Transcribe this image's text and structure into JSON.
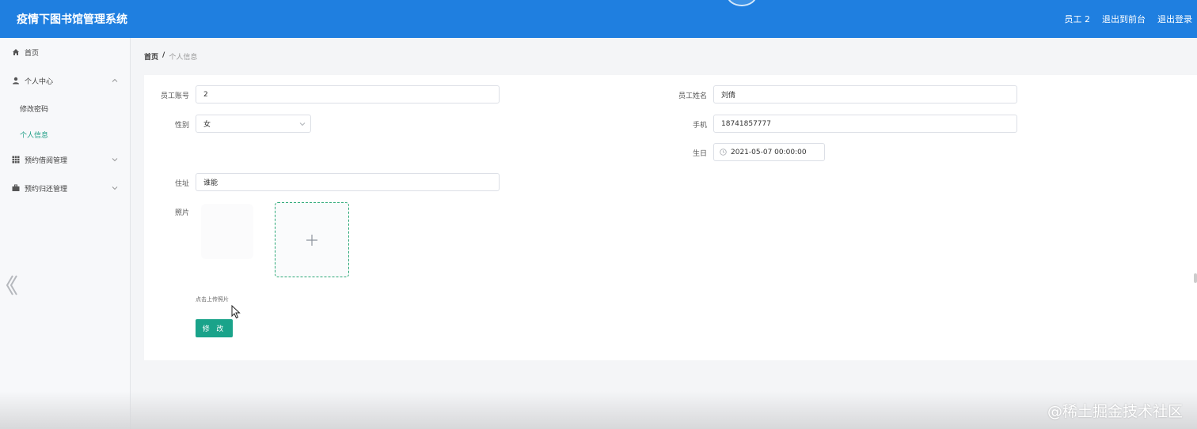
{
  "header": {
    "app_title": "疫情下图书馆管理系统",
    "user_label": "员工 2",
    "exit_front_label": "退出到前台",
    "logout_label": "退出登录"
  },
  "sidebar": {
    "home": "首页",
    "personal_center": "个人中心",
    "change_password": "修改密码",
    "personal_info": "个人信息",
    "reservation_borrow": "预约借阅管理",
    "reservation_return": "预约归还管理"
  },
  "breadcrumb": {
    "home": "首页",
    "separator": "/",
    "current": "个人信息"
  },
  "form": {
    "account_label": "员工账号",
    "account_value": "2",
    "name_label": "员工姓名",
    "name_value": "刘倩",
    "gender_label": "性别",
    "gender_value": "女",
    "phone_label": "手机",
    "phone_value": "18741857777",
    "birthday_label": "生日",
    "birthday_value": "2021-05-07 00:00:00",
    "address_label": "住址",
    "address_value": "谁能",
    "photo_label": "照片",
    "upload_hint": "点击上传照片",
    "submit_label": "修 改"
  },
  "watermark": "@稀土掘金技术社区",
  "colors": {
    "header_bg": "#1f7fe0",
    "accent": "#1aa38a",
    "active_menu": "#1f9e86"
  }
}
